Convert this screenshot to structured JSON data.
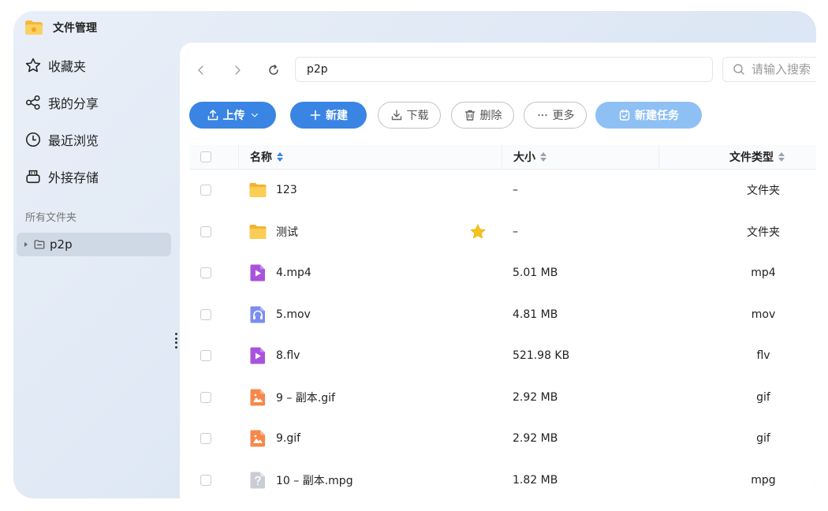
{
  "app": {
    "title": "文件管理"
  },
  "sidebar": {
    "items": [
      {
        "label": "收藏夹",
        "icon": "star-outline-icon"
      },
      {
        "label": "我的分享",
        "icon": "share-icon"
      },
      {
        "label": "最近浏览",
        "icon": "clock-icon"
      },
      {
        "label": "外接存储",
        "icon": "external-storage-icon"
      }
    ],
    "section_label": "所有文件夹",
    "tree": [
      {
        "label": "p2p",
        "icon": "folder-outline-icon"
      }
    ]
  },
  "toolbar": {
    "path": "p2p",
    "search_placeholder": "请输入搜索"
  },
  "actions": {
    "upload": "上传",
    "new": "新建",
    "download": "下载",
    "delete": "删除",
    "more": "更多",
    "new_task": "新建任务"
  },
  "table": {
    "headers": {
      "name": "名称",
      "size": "大小",
      "type": "文件类型"
    },
    "rows": [
      {
        "name": "123",
        "size": "–",
        "type": "文件夹",
        "icon": "folder-icon",
        "favorite": false
      },
      {
        "name": "测试",
        "size": "–",
        "type": "文件夹",
        "icon": "folder-icon",
        "favorite": true
      },
      {
        "name": "4.mp4",
        "size": "5.01 MB",
        "type": "mp4",
        "icon": "video-icon",
        "favorite": false
      },
      {
        "name": "5.mov",
        "size": "4.81 MB",
        "type": "mov",
        "icon": "audio-icon",
        "favorite": false
      },
      {
        "name": "8.flv",
        "size": "521.98 KB",
        "type": "flv",
        "icon": "video-icon",
        "favorite": false
      },
      {
        "name": "9 – 副本.gif",
        "size": "2.92 MB",
        "type": "gif",
        "icon": "image-icon",
        "favorite": false
      },
      {
        "name": "9.gif",
        "size": "2.92 MB",
        "type": "gif",
        "icon": "image-icon",
        "favorite": false
      },
      {
        "name": "10 – 副本.mpg",
        "size": "1.82 MB",
        "type": "mpg",
        "icon": "unknown-file-icon",
        "favorite": false
      }
    ]
  },
  "colors": {
    "primary": "#3a84e4",
    "primary_disabled": "#8fc0f4",
    "folder": "#f9c44a",
    "video": "#a953dc",
    "audio": "#7b8ef0",
    "image": "#f7884a",
    "unknown": "#c9cdd2",
    "star": "#f4c21b"
  }
}
